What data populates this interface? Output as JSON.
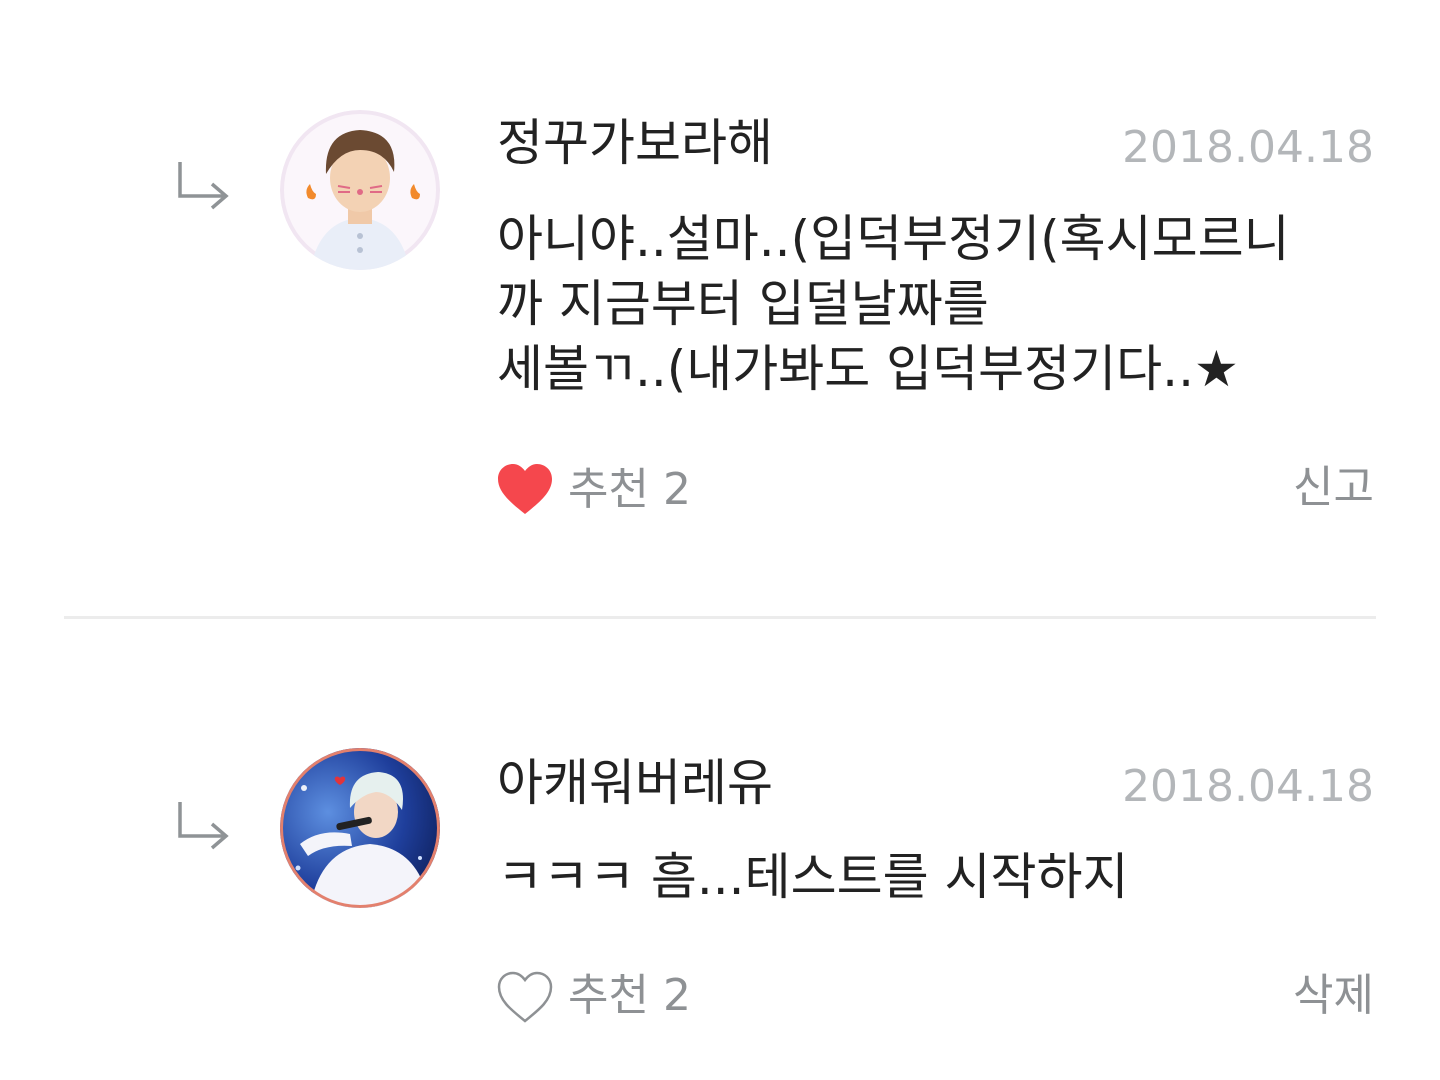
{
  "comments": [
    {
      "username": "정꾸가보라해",
      "date": "2018.04.18",
      "body_lines": [
        "아니야..설마..(입덕부정기(혹시모르니",
        "까 지금부터 입덜날짜를",
        "세볼ㄲ..(내가봐도 입덕부정기다..★"
      ],
      "like_label": "추천 2",
      "liked": true,
      "heart_color": "#f5474d",
      "action_label": "신고"
    },
    {
      "username": "아캐워버레유",
      "date": "2018.04.18",
      "body_lines": [
        "ㅋㅋㅋ 흠...테스트를 시작하지"
      ],
      "like_label": "추천 2",
      "liked": false,
      "heart_color": "#8e9194",
      "action_label": "삭제"
    }
  ],
  "icons": {
    "reply": "reply-arrow-icon",
    "like_filled": "heart-filled-icon",
    "like_outline": "heart-outline-icon"
  }
}
